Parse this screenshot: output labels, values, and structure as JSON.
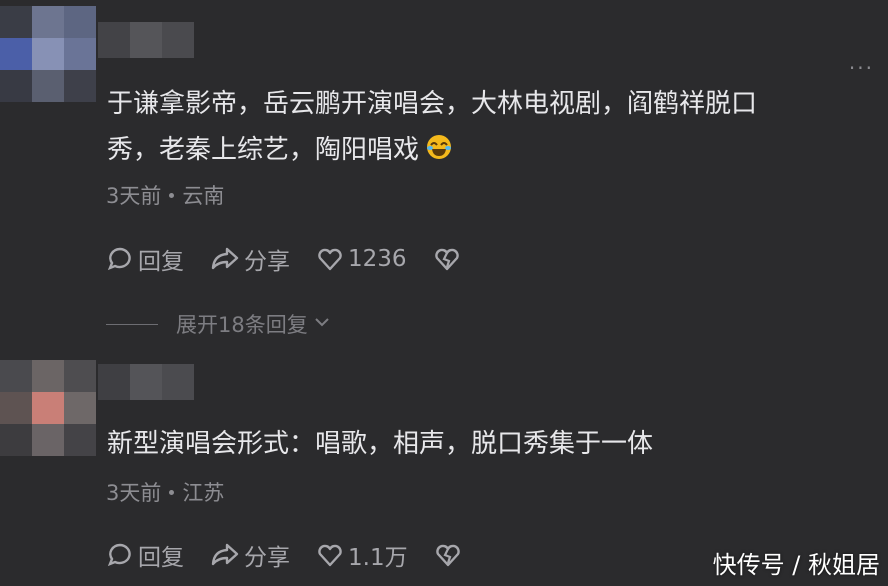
{
  "comments": [
    {
      "text_line1": "于谦拿影帝，岳云鹏开演唱会，大林电视剧，阎鹤祥脱口",
      "text_line2": "秀，老秦上综艺，陶阳唱戏",
      "time": "3天前",
      "location": "云南",
      "reply_label": "回复",
      "share_label": "分享",
      "like_count": "1236",
      "more_label": "···"
    },
    {
      "text_line1": "新型演唱会形式：唱歌，相声，脱口秀集于一体",
      "time": "3天前",
      "location": "江苏",
      "reply_label": "回复",
      "share_label": "分享",
      "like_count": "1.1万"
    }
  ],
  "expand_replies_label": "展开18条回复",
  "watermark": "快传号 / 秋姐居",
  "colors": {
    "background": "#2b2b2d",
    "text": "#e7e7ea",
    "meta": "#8d8d92"
  },
  "icons": [
    "reply-bubble-icon",
    "share-arrow-icon",
    "heart-icon",
    "broken-heart-icon",
    "chevron-down-icon",
    "laughing-emoji-icon"
  ]
}
